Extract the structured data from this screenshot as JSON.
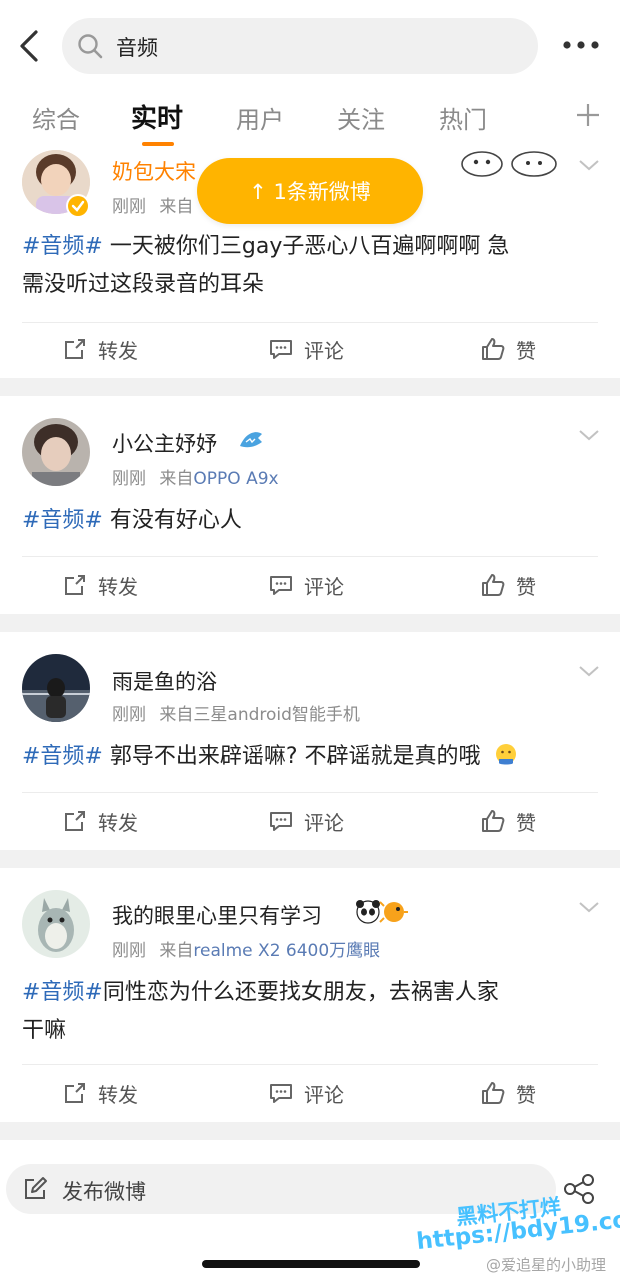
{
  "header": {
    "search_value": "音频",
    "tabs": [
      {
        "label": "综合"
      },
      {
        "label": "实时"
      },
      {
        "label": "用户"
      },
      {
        "label": "关注"
      },
      {
        "label": "热门"
      }
    ],
    "active_tab": "实时",
    "accent_color": "#ff8200"
  },
  "toast": {
    "label": "↑ 1条新微博"
  },
  "posts": [
    {
      "username": "奶包大宋",
      "time": "刚刚",
      "source_prefix": "来自",
      "source": "",
      "hashtag": "#音频#",
      "text_line1": " 一天被你们三gay子恶心八百遍啊啊啊 急",
      "text_line2": "需没听过这段录音的耳朵",
      "actions": {
        "repost": "转发",
        "comment": "评论",
        "like": "赞"
      }
    },
    {
      "username": "小公主妤妤",
      "time": "刚刚",
      "source_prefix": "来自",
      "source": "OPPO A9x",
      "hashtag": "#音频#",
      "text_line1": " 有没有好心人",
      "actions": {
        "repost": "转发",
        "comment": "评论",
        "like": "赞"
      }
    },
    {
      "username": "雨是鱼的浴",
      "time": "刚刚",
      "source_prefix": "来自",
      "source": "三星android智能手机",
      "hashtag": "#音频#",
      "text_line1": " 郭导不出来辟谣嘛? 不辟谣就是真的哦",
      "actions": {
        "repost": "转发",
        "comment": "评论",
        "like": "赞"
      }
    },
    {
      "username": "我的眼里心里只有学习",
      "time": "刚刚",
      "source_prefix": "来自",
      "source": "realme X2 6400万鹰眼",
      "hashtag": "#音频#",
      "text_line1": "同性恋为什么还要找女朋友，去祸害人家",
      "text_line2": "干嘛",
      "actions": {
        "repost": "转发",
        "comment": "评论",
        "like": "赞"
      }
    }
  ],
  "compose": {
    "label": "发布微博"
  },
  "watermark": {
    "line1": "黑料不打烊",
    "line2": "https://bdy19.co",
    "credit": "@爱追星的小助理"
  },
  "colors": {
    "hashtag": "#2e6ab8",
    "source": "#5a7bb4",
    "toast": "#ffb400",
    "username_highlight": "#ff8200"
  }
}
